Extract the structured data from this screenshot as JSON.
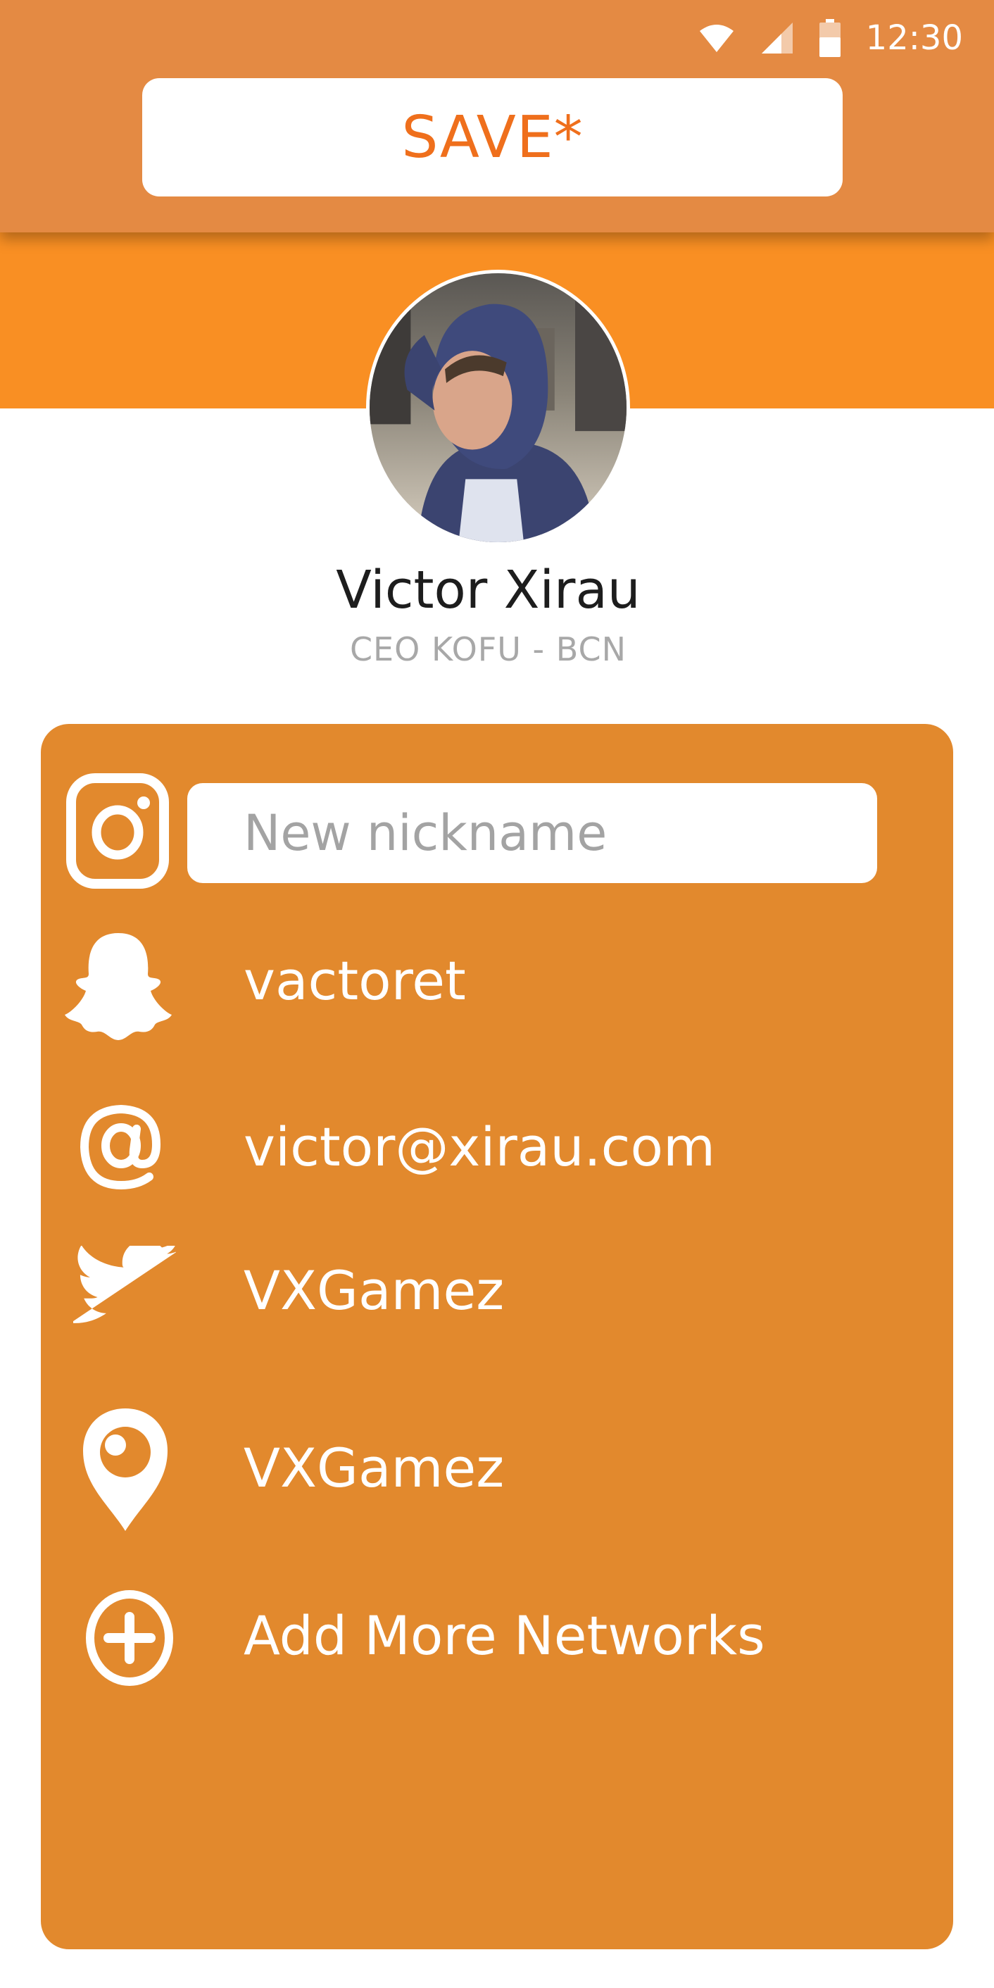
{
  "status_bar": {
    "time": "12:30",
    "icons": [
      "wifi-icon",
      "signal-icon",
      "battery-icon"
    ]
  },
  "toolbar": {
    "save_label": "SAVE*"
  },
  "profile": {
    "name": "Victor Xirau",
    "title": "CEO KOFU - BCN"
  },
  "networks": {
    "instagram": {
      "icon": "instagram-icon",
      "placeholder": "New nickname",
      "value": ""
    },
    "snapchat": {
      "icon": "snapchat-ghost-icon",
      "value": "vactoret"
    },
    "email": {
      "icon": "at-sign-icon",
      "value": "victor@xirau.com"
    },
    "twitter": {
      "icon": "twitter-bird-icon",
      "value": "VXGamez"
    },
    "periscope": {
      "icon": "periscope-pin-icon",
      "value": "VXGamez"
    },
    "add_more": {
      "icon": "plus-circle-icon",
      "label": "Add More Networks"
    }
  },
  "colors": {
    "topbar": "#e48a43",
    "header_band": "#f98f23",
    "card": "#e2892d",
    "save_text": "#ef6f1c"
  }
}
